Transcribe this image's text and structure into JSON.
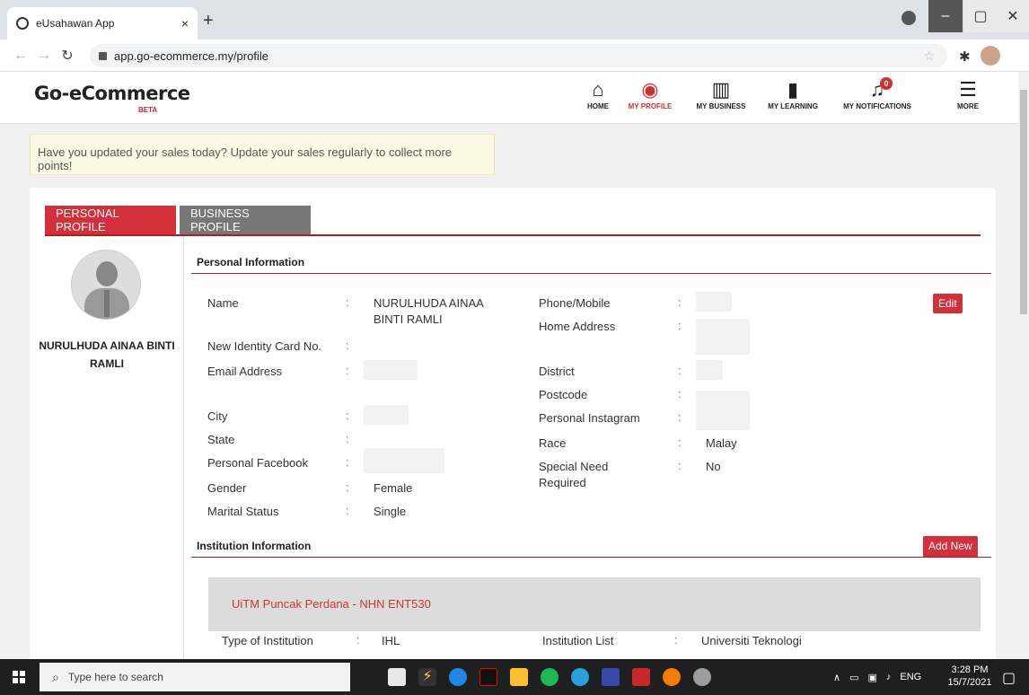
{
  "browser": {
    "tab_title": "eUsahawan App",
    "tab_close": "×",
    "new_tab": "+",
    "url": "app.go-ecommerce.my/profile",
    "min": "–",
    "max": "▢",
    "close": "✕"
  },
  "app": {
    "logo": "Go-eCommerce",
    "beta": "BETA",
    "nav": {
      "home": "HOME",
      "profile": "MY PROFILE",
      "business": "MY BUSINESS",
      "learning": "MY LEARNING",
      "notifications": "MY NOTIFICATIONS",
      "notif_count": "0",
      "more": "MORE"
    }
  },
  "banner": "Have you updated your sales today? Update your sales regularly to collect more points!",
  "tabs": {
    "personal": "PERSONAL PROFILE",
    "business": "BUSINESS PROFILE"
  },
  "profile_name": "NURULHUDA AINAA BINTI RAMLI",
  "personal": {
    "heading": "Personal Information",
    "edit": "Edit",
    "labels": {
      "name": "Name",
      "ic": "New Identity Card No.",
      "email": "Email Address",
      "city": "City",
      "state": "State",
      "facebook": "Personal Facebook",
      "gender": "Gender",
      "marital": "Marital Status",
      "phone": "Phone/Mobile",
      "address": "Home Address",
      "district": "District",
      "postcode": "Postcode",
      "instagram": "Personal Instagram",
      "race": "Race",
      "special": "Special Need Required"
    },
    "values": {
      "name": "NURULHUDA AINAA BINTI RAMLI",
      "gender": "Female",
      "marital": "Single",
      "race": "Malay",
      "special": "No"
    },
    "colon": ":"
  },
  "institution": {
    "heading": "Institution Information",
    "add": "Add New",
    "entry": "UiTM Puncak Perdana - NHN ENT530",
    "type_label": "Type of Institution",
    "type_value": "IHL",
    "list_label": "Institution List",
    "list_value": "Universiti Teknologi MARA"
  },
  "taskbar": {
    "search": "Type here to search",
    "lang": "ENG",
    "time": "3:28 PM",
    "date": "15/7/2021"
  }
}
